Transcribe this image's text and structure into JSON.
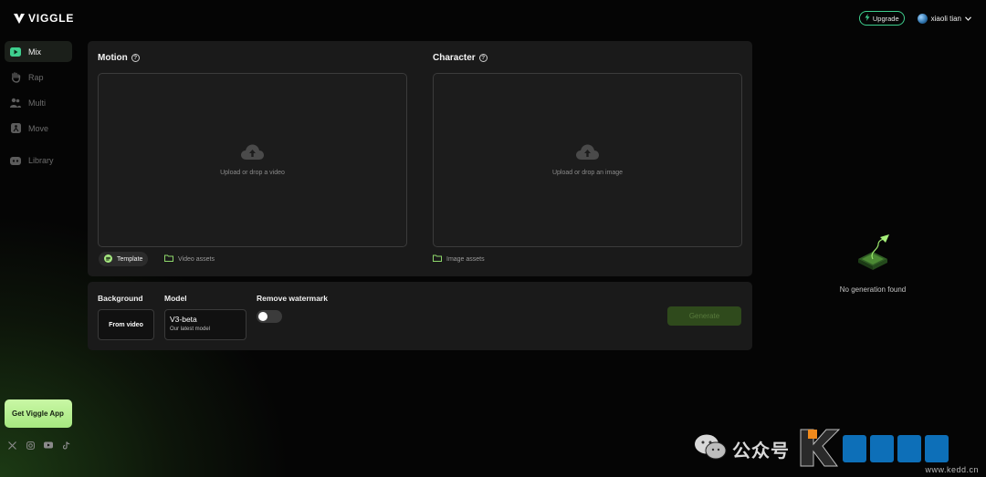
{
  "app": {
    "brand": "VIGGLE"
  },
  "sidebar": {
    "items": [
      {
        "label": "Mix",
        "icon": "play-square-icon"
      },
      {
        "label": "Rap",
        "icon": "hand-icon"
      },
      {
        "label": "Multi",
        "icon": "users-icon"
      },
      {
        "label": "Move",
        "icon": "person-move-icon"
      },
      {
        "label": "Library",
        "icon": "library-icon"
      }
    ],
    "get_app": "Get Viggle App",
    "socials": [
      "x-icon",
      "instagram-icon",
      "youtube-icon",
      "tiktok-icon"
    ]
  },
  "header": {
    "upgrade": "Upgrade",
    "user_name": "xiaoli tian"
  },
  "motion": {
    "title": "Motion",
    "dropzone_text": "Upload or drop a video",
    "template": "Template",
    "assets": "Video assets"
  },
  "character": {
    "title": "Character",
    "dropzone_text": "Upload or drop an image",
    "assets": "Image assets"
  },
  "options": {
    "background_label": "Background",
    "background_value": "From video",
    "model_label": "Model",
    "model_name": "V3-beta",
    "model_sub": "Our latest model",
    "watermark_label": "Remove watermark",
    "watermark_on": false,
    "generate": "Generate"
  },
  "results": {
    "empty_text": "No generation found"
  },
  "watermark": {
    "label": "公众号",
    "site": "www.kedd.cn"
  },
  "colors": {
    "accent": "#3ecf8e",
    "generate_bg": "#2f4a1c",
    "app_button": "#b8f290"
  }
}
